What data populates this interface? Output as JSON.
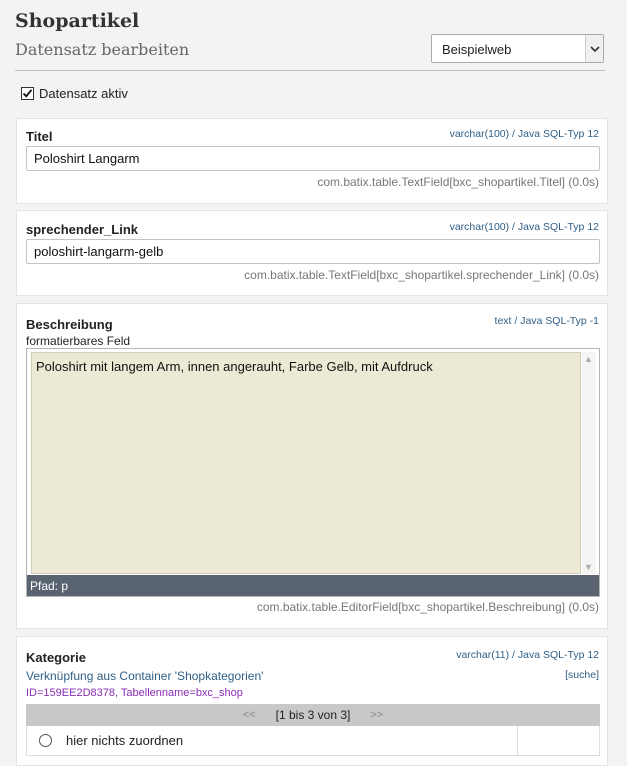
{
  "header": {
    "title": "Shopartikel",
    "subtitle": "Datensatz bearbeiten",
    "site_select": "Beispielweb",
    "active_label": "Datensatz aktiv",
    "active_checked": true
  },
  "fields": {
    "titel": {
      "label": "Titel",
      "type": "varchar(100) / Java SQL-Typ 12",
      "value": "Poloshirt Langarm",
      "class": "com.batix.table.TextField[bxc_shopartikel.Titel] (0.0s)"
    },
    "link": {
      "label": "sprechender_Link",
      "type": "varchar(100) / Java SQL-Typ 12",
      "value": "poloshirt-langarm-gelb",
      "class": "com.batix.table.TextField[bxc_shopartikel.sprechender_Link] (0.0s)"
    },
    "beschreibung": {
      "label": "Beschreibung",
      "type": "text / Java SQL-Typ -1",
      "sub": "formatierbares Feld",
      "value": "Poloshirt mit langem Arm, innen angerauht, Farbe Gelb, mit Aufdruck",
      "path": "Pfad: p",
      "class": "com.batix.table.EditorField[bxc_shopartikel.Beschreibung] (0.0s)"
    },
    "kategorie": {
      "label": "Kategorie",
      "type": "varchar(11) / Java SQL-Typ 12",
      "link_desc": "Verknüpfung aus Container 'Shopkategorien'",
      "meta": "ID=159EE2D8378, Tabellenname=bxc_shop",
      "search": "[suche]",
      "pager_prev": "<<",
      "pager_info": "[1 bis 3 von 3]",
      "pager_next": ">>",
      "option_none": "hier nichts zuordnen"
    }
  }
}
